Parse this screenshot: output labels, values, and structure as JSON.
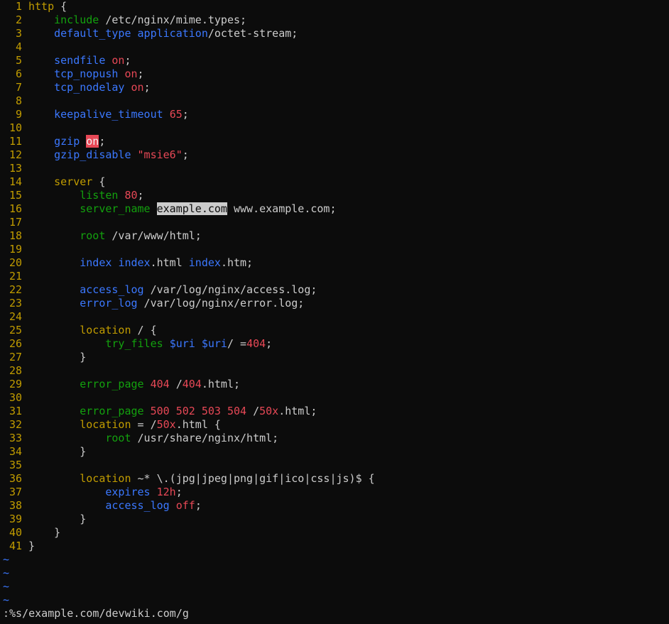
{
  "colors": {
    "background": "#0c0c0c",
    "line_number": "#c19c00",
    "keyword": "#c19c00",
    "directive_blue": "#3b78ff",
    "directive_green": "#13a10e",
    "value_red": "#e74856",
    "text": "#cccccc"
  },
  "editor": {
    "lines": [
      {
        "n": "1",
        "segs": [
          {
            "t": "http",
            "c": "kw"
          },
          {
            "t": " {",
            "c": "txt"
          }
        ]
      },
      {
        "n": "2",
        "segs": [
          {
            "t": "    ",
            "c": "txt"
          },
          {
            "t": "include",
            "c": "dirg"
          },
          {
            "t": " /etc/nginx/mime.types;",
            "c": "txt"
          }
        ]
      },
      {
        "n": "3",
        "segs": [
          {
            "t": "    ",
            "c": "txt"
          },
          {
            "t": "default_type",
            "c": "dir"
          },
          {
            "t": " ",
            "c": "txt"
          },
          {
            "t": "application",
            "c": "dir"
          },
          {
            "t": "/octet-stream;",
            "c": "txt"
          }
        ]
      },
      {
        "n": "4",
        "segs": []
      },
      {
        "n": "5",
        "segs": [
          {
            "t": "    ",
            "c": "txt"
          },
          {
            "t": "sendfile",
            "c": "dir"
          },
          {
            "t": " ",
            "c": "txt"
          },
          {
            "t": "on",
            "c": "num"
          },
          {
            "t": ";",
            "c": "txt"
          }
        ]
      },
      {
        "n": "6",
        "segs": [
          {
            "t": "    ",
            "c": "txt"
          },
          {
            "t": "tcp_nopush",
            "c": "dir"
          },
          {
            "t": " ",
            "c": "txt"
          },
          {
            "t": "on",
            "c": "num"
          },
          {
            "t": ";",
            "c": "txt"
          }
        ]
      },
      {
        "n": "7",
        "segs": [
          {
            "t": "    ",
            "c": "txt"
          },
          {
            "t": "tcp_nodelay",
            "c": "dir"
          },
          {
            "t": " ",
            "c": "txt"
          },
          {
            "t": "on",
            "c": "num"
          },
          {
            "t": ";",
            "c": "txt"
          }
        ]
      },
      {
        "n": "8",
        "segs": []
      },
      {
        "n": "9",
        "segs": [
          {
            "t": "    ",
            "c": "txt"
          },
          {
            "t": "keepalive_timeout",
            "c": "dir"
          },
          {
            "t": " ",
            "c": "txt"
          },
          {
            "t": "65",
            "c": "num"
          },
          {
            "t": ";",
            "c": "txt"
          }
        ]
      },
      {
        "n": "10",
        "segs": []
      },
      {
        "n": "11",
        "segs": [
          {
            "t": "    ",
            "c": "txt"
          },
          {
            "t": "gzip",
            "c": "dir"
          },
          {
            "t": " ",
            "c": "txt"
          },
          {
            "t": "on",
            "c": "hl"
          },
          {
            "t": ";",
            "c": "txt"
          }
        ]
      },
      {
        "n": "12",
        "segs": [
          {
            "t": "    ",
            "c": "txt"
          },
          {
            "t": "gzip_disable",
            "c": "dir"
          },
          {
            "t": " ",
            "c": "txt"
          },
          {
            "t": "\"msie6\"",
            "c": "str"
          },
          {
            "t": ";",
            "c": "txt"
          }
        ]
      },
      {
        "n": "13",
        "segs": []
      },
      {
        "n": "14",
        "segs": [
          {
            "t": "    ",
            "c": "txt"
          },
          {
            "t": "server",
            "c": "kw"
          },
          {
            "t": " {",
            "c": "txt"
          }
        ]
      },
      {
        "n": "15",
        "segs": [
          {
            "t": "        ",
            "c": "txt"
          },
          {
            "t": "listen",
            "c": "dirg"
          },
          {
            "t": " ",
            "c": "txt"
          },
          {
            "t": "80",
            "c": "num"
          },
          {
            "t": ";",
            "c": "txt"
          }
        ]
      },
      {
        "n": "16",
        "segs": [
          {
            "t": "        ",
            "c": "txt"
          },
          {
            "t": "server_name",
            "c": "dirg"
          },
          {
            "t": " ",
            "c": "txt"
          },
          {
            "t": "example.com",
            "c": "vis"
          },
          {
            "t": " www.example.com;",
            "c": "txt"
          }
        ]
      },
      {
        "n": "17",
        "segs": []
      },
      {
        "n": "18",
        "segs": [
          {
            "t": "        ",
            "c": "txt"
          },
          {
            "t": "root",
            "c": "dirg"
          },
          {
            "t": " /var/www/html;",
            "c": "txt"
          }
        ]
      },
      {
        "n": "19",
        "segs": []
      },
      {
        "n": "20",
        "segs": [
          {
            "t": "        ",
            "c": "txt"
          },
          {
            "t": "index",
            "c": "dir"
          },
          {
            "t": " ",
            "c": "txt"
          },
          {
            "t": "index",
            "c": "dir"
          },
          {
            "t": ".html ",
            "c": "txt"
          },
          {
            "t": "index",
            "c": "dir"
          },
          {
            "t": ".htm;",
            "c": "txt"
          }
        ]
      },
      {
        "n": "21",
        "segs": []
      },
      {
        "n": "22",
        "segs": [
          {
            "t": "        ",
            "c": "txt"
          },
          {
            "t": "access_log",
            "c": "dir"
          },
          {
            "t": " /var/log/nginx/access.log;",
            "c": "txt"
          }
        ]
      },
      {
        "n": "23",
        "segs": [
          {
            "t": "        ",
            "c": "txt"
          },
          {
            "t": "error_log",
            "c": "dir"
          },
          {
            "t": " /var/log/nginx/error.log;",
            "c": "txt"
          }
        ]
      },
      {
        "n": "24",
        "segs": []
      },
      {
        "n": "25",
        "segs": [
          {
            "t": "        ",
            "c": "txt"
          },
          {
            "t": "location",
            "c": "kw"
          },
          {
            "t": " / {",
            "c": "txt"
          }
        ]
      },
      {
        "n": "26",
        "segs": [
          {
            "t": "            ",
            "c": "txt"
          },
          {
            "t": "try_files",
            "c": "dirg"
          },
          {
            "t": " ",
            "c": "txt"
          },
          {
            "t": "$uri",
            "c": "var"
          },
          {
            "t": " ",
            "c": "txt"
          },
          {
            "t": "$uri",
            "c": "var"
          },
          {
            "t": "/ =",
            "c": "txt"
          },
          {
            "t": "404",
            "c": "num"
          },
          {
            "t": ";",
            "c": "txt"
          }
        ]
      },
      {
        "n": "27",
        "segs": [
          {
            "t": "        }",
            "c": "txt"
          }
        ]
      },
      {
        "n": "28",
        "segs": []
      },
      {
        "n": "29",
        "segs": [
          {
            "t": "        ",
            "c": "txt"
          },
          {
            "t": "error_page",
            "c": "dirg"
          },
          {
            "t": " ",
            "c": "txt"
          },
          {
            "t": "404",
            "c": "num"
          },
          {
            "t": " /",
            "c": "txt"
          },
          {
            "t": "404",
            "c": "num"
          },
          {
            "t": ".html;",
            "c": "txt"
          }
        ]
      },
      {
        "n": "30",
        "segs": []
      },
      {
        "n": "31",
        "segs": [
          {
            "t": "        ",
            "c": "txt"
          },
          {
            "t": "error_page",
            "c": "dirg"
          },
          {
            "t": " ",
            "c": "txt"
          },
          {
            "t": "500",
            "c": "num"
          },
          {
            "t": " ",
            "c": "txt"
          },
          {
            "t": "502",
            "c": "num"
          },
          {
            "t": " ",
            "c": "txt"
          },
          {
            "t": "503",
            "c": "num"
          },
          {
            "t": " ",
            "c": "txt"
          },
          {
            "t": "504",
            "c": "num"
          },
          {
            "t": " /",
            "c": "txt"
          },
          {
            "t": "50x",
            "c": "num"
          },
          {
            "t": ".html;",
            "c": "txt"
          }
        ]
      },
      {
        "n": "32",
        "segs": [
          {
            "t": "        ",
            "c": "txt"
          },
          {
            "t": "location",
            "c": "kw"
          },
          {
            "t": " = /",
            "c": "txt"
          },
          {
            "t": "50x",
            "c": "num"
          },
          {
            "t": ".html {",
            "c": "txt"
          }
        ]
      },
      {
        "n": "33",
        "segs": [
          {
            "t": "            ",
            "c": "txt"
          },
          {
            "t": "root",
            "c": "dirg"
          },
          {
            "t": " /usr/share/nginx/html;",
            "c": "txt"
          }
        ]
      },
      {
        "n": "34",
        "segs": [
          {
            "t": "        }",
            "c": "txt"
          }
        ]
      },
      {
        "n": "35",
        "segs": []
      },
      {
        "n": "36",
        "segs": [
          {
            "t": "        ",
            "c": "txt"
          },
          {
            "t": "location",
            "c": "kw"
          },
          {
            "t": " ~* \\.(jpg|jpeg|png|gif|ico|css|js)$ {",
            "c": "txt"
          }
        ]
      },
      {
        "n": "37",
        "segs": [
          {
            "t": "            ",
            "c": "txt"
          },
          {
            "t": "expires",
            "c": "dir"
          },
          {
            "t": " ",
            "c": "txt"
          },
          {
            "t": "12h",
            "c": "num"
          },
          {
            "t": ";",
            "c": "txt"
          }
        ]
      },
      {
        "n": "38",
        "segs": [
          {
            "t": "            ",
            "c": "txt"
          },
          {
            "t": "access_log",
            "c": "dir"
          },
          {
            "t": " ",
            "c": "txt"
          },
          {
            "t": "off",
            "c": "num"
          },
          {
            "t": ";",
            "c": "txt"
          }
        ]
      },
      {
        "n": "39",
        "segs": [
          {
            "t": "        }",
            "c": "txt"
          }
        ]
      },
      {
        "n": "40",
        "segs": [
          {
            "t": "    }",
            "c": "txt"
          }
        ]
      },
      {
        "n": "41",
        "segs": [
          {
            "t": "}",
            "c": "txt"
          }
        ]
      }
    ],
    "empty_markers": [
      "~",
      "~",
      "~",
      "~"
    ]
  },
  "command_line": ":%s/example.com/devwiki.com/g"
}
